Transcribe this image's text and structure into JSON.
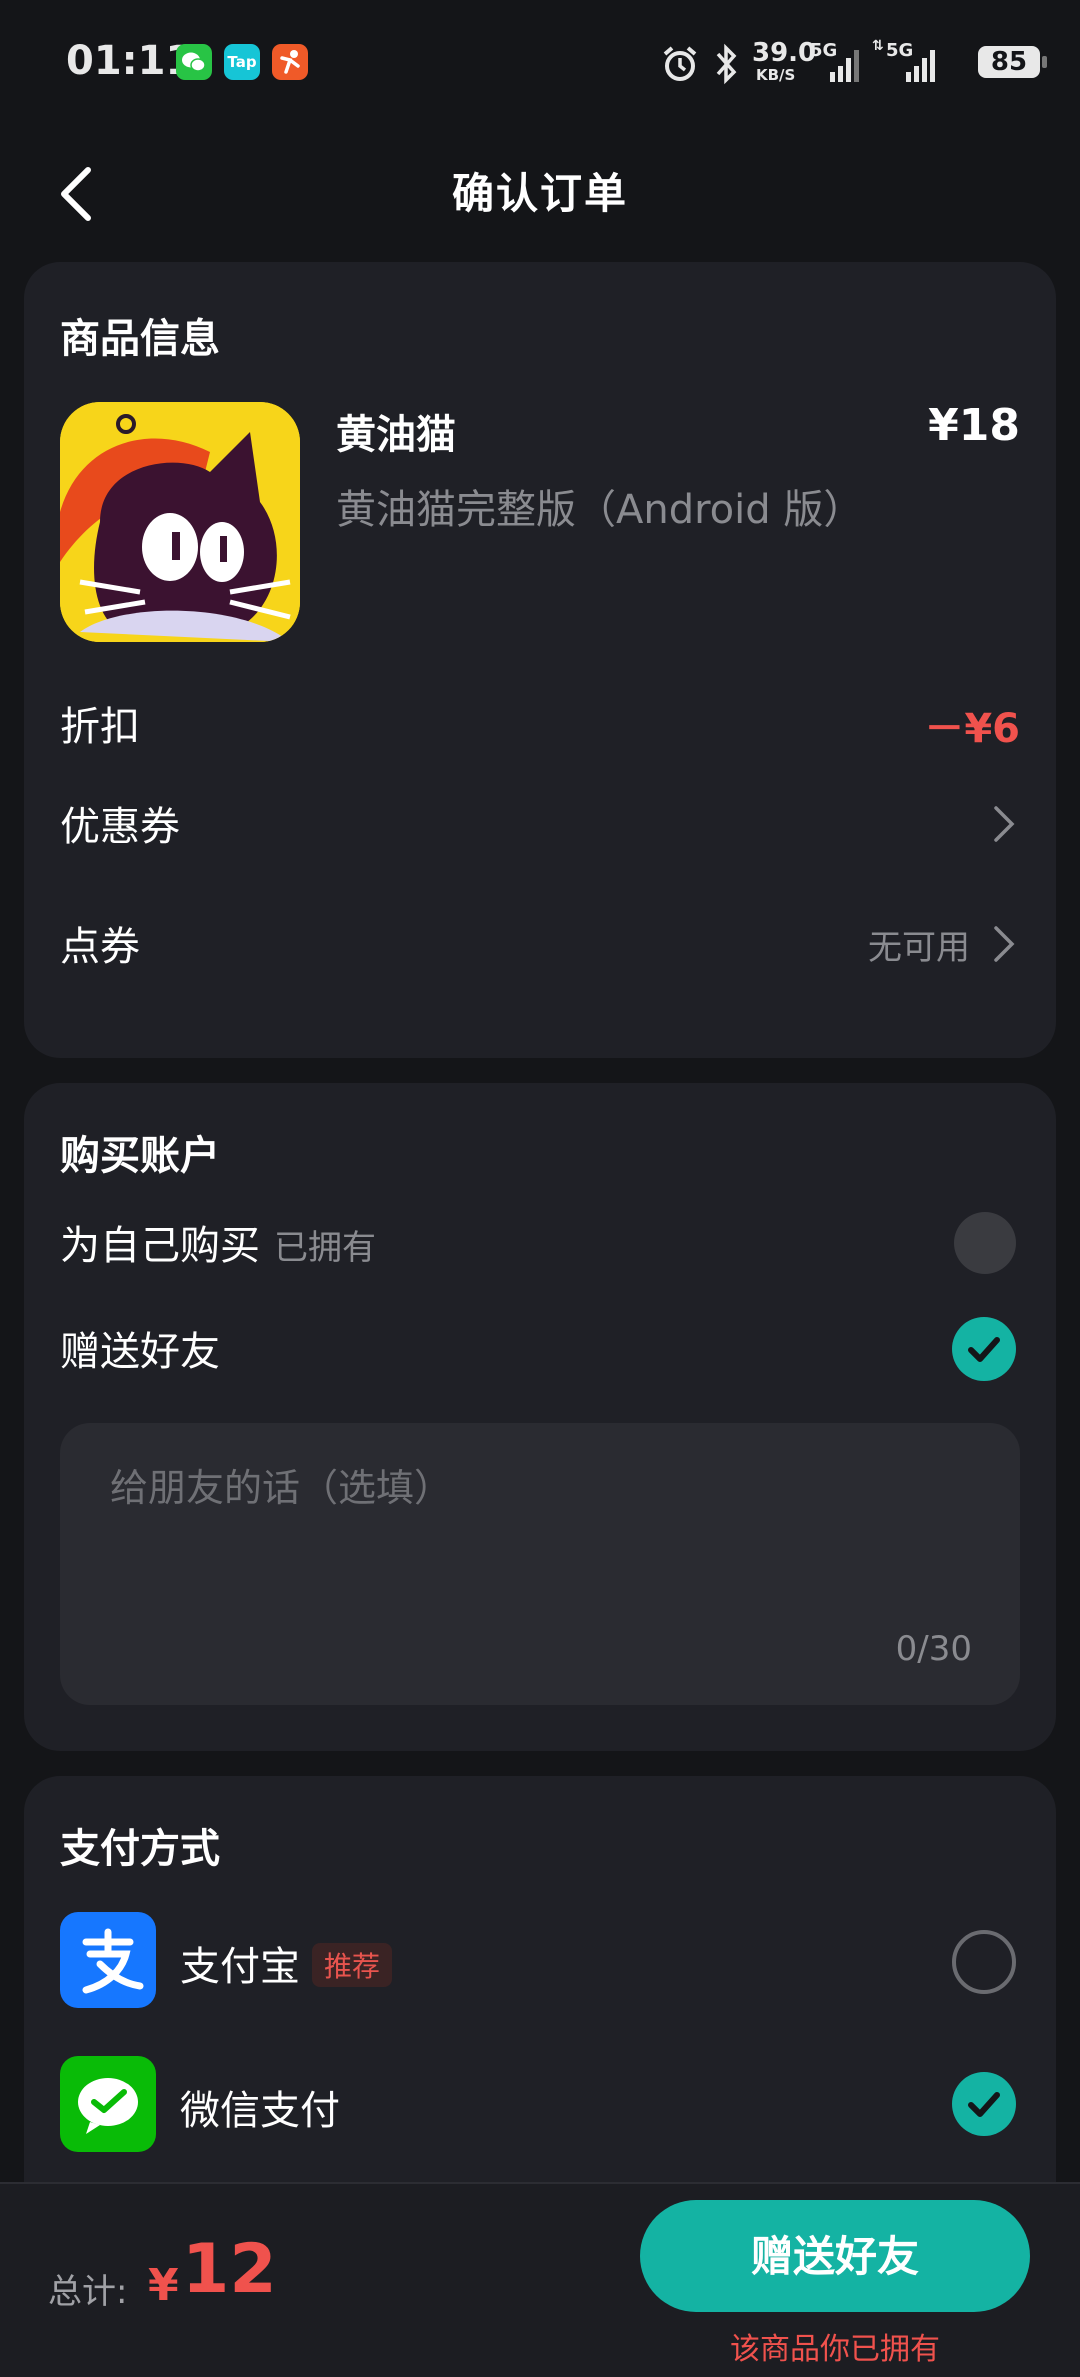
{
  "status_bar": {
    "time": "01:11",
    "apps": [
      {
        "icon": "wechat-icon",
        "label": "",
        "color": "#28c445"
      },
      {
        "icon": "taptap-icon",
        "label": "Tap",
        "color": "#16c5d6"
      },
      {
        "icon": "app-runner-icon",
        "label": "",
        "color": "#f05a28"
      }
    ],
    "net_speed": "39.0",
    "net_unit": "KB/S",
    "signal1": "5G",
    "signal2": "5G",
    "battery": "85"
  },
  "header": {
    "title": "确认订单",
    "back_icon": "chevron-left-icon"
  },
  "product": {
    "section_title": "商品信息",
    "name": "黄油猫",
    "price": "¥18",
    "subtitle": "黄油猫完整版（Android 版）",
    "discount_label": "折扣",
    "discount_value": "－¥6",
    "coupon_label": "优惠券",
    "points_label": "点券",
    "points_value": "无可用"
  },
  "account": {
    "section_title": "购买账户",
    "self_label": "为自己购买",
    "self_tag": "已拥有",
    "friend_label": "赠送好友",
    "message_placeholder": "给朋友的话（选填）",
    "message_counter": "0/30"
  },
  "payment": {
    "section_title": "支付方式",
    "methods": [
      {
        "label": "支付宝",
        "badge": "推荐",
        "icon": "alipay-icon",
        "color": "#1677ff",
        "selected": false
      },
      {
        "label": "微信支付",
        "badge": "",
        "icon": "wechat-pay-icon",
        "color": "#09bb07",
        "selected": true
      }
    ]
  },
  "footer": {
    "total_label": "总计:",
    "currency": "¥",
    "total_amount": "12",
    "button_label": "赠送好友",
    "owned_note": "该商品你已拥有"
  },
  "colors": {
    "accent": "#14b3a3",
    "price_red": "#f0524d",
    "card_bg": "#1f2026",
    "page_bg": "#141518"
  }
}
